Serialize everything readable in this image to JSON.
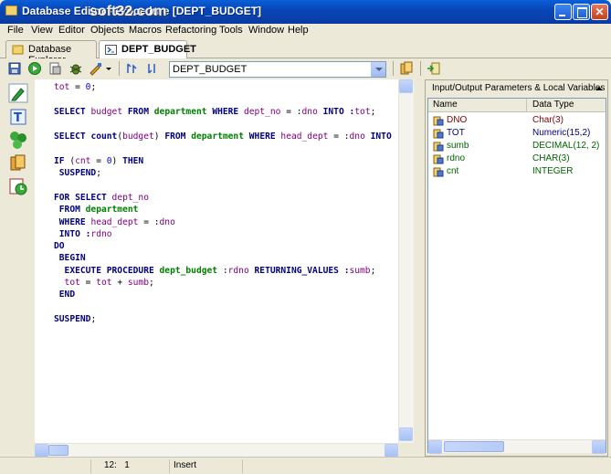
{
  "window": {
    "title": "Database Editor - Procedure [DEPT_BUDGET]",
    "watermark": "soft32.com"
  },
  "menu": [
    "File",
    "View",
    "Editor",
    "Objects",
    "Macros",
    "Refactoring",
    "Tools",
    "Window",
    "Help"
  ],
  "tabs": [
    {
      "label": "Database Explorer",
      "icon": "database-explorer-icon"
    },
    {
      "label": "DEPT_BUDGET",
      "icon": "procedure-icon"
    }
  ],
  "toolbar": {
    "procedure_select_value": "DEPT_BUDGET"
  },
  "colors": {
    "keyword": "#000080",
    "identifier": "#008000",
    "variable": "#800080",
    "number": "#0000ff"
  },
  "code_lines": [
    [
      {
        "t": "tot",
        "c": "var"
      },
      {
        "t": " = ",
        "c": "plain"
      },
      {
        "t": "0",
        "c": "num"
      },
      {
        "t": ";",
        "c": "plain"
      }
    ],
    [],
    [
      {
        "t": "SELECT ",
        "c": "kw"
      },
      {
        "t": "budget ",
        "c": "var"
      },
      {
        "t": "FROM ",
        "c": "kw"
      },
      {
        "t": "department ",
        "c": "id"
      },
      {
        "t": "WHERE ",
        "c": "kw"
      },
      {
        "t": "dept_no ",
        "c": "var"
      },
      {
        "t": "= :",
        "c": "plain"
      },
      {
        "t": "dno ",
        "c": "var"
      },
      {
        "t": "INTO :",
        "c": "kw"
      },
      {
        "t": "tot",
        "c": "var"
      },
      {
        "t": ";",
        "c": "plain"
      }
    ],
    [],
    [
      {
        "t": "SELECT ",
        "c": "kw"
      },
      {
        "t": "count",
        "c": "kw"
      },
      {
        "t": "(",
        "c": "plain"
      },
      {
        "t": "budget",
        "c": "var"
      },
      {
        "t": ") ",
        "c": "plain"
      },
      {
        "t": "FROM ",
        "c": "kw"
      },
      {
        "t": "department ",
        "c": "id"
      },
      {
        "t": "WHERE ",
        "c": "kw"
      },
      {
        "t": "head_dept ",
        "c": "var"
      },
      {
        "t": "= :",
        "c": "plain"
      },
      {
        "t": "dno ",
        "c": "var"
      },
      {
        "t": "INTO",
        "c": "kw"
      }
    ],
    [],
    [
      {
        "t": "IF ",
        "c": "kw"
      },
      {
        "t": "(",
        "c": "plain"
      },
      {
        "t": "cnt",
        "c": "var"
      },
      {
        "t": " = ",
        "c": "plain"
      },
      {
        "t": "0",
        "c": "num"
      },
      {
        "t": ") ",
        "c": "plain"
      },
      {
        "t": "THEN",
        "c": "kw"
      }
    ],
    [
      {
        "t": " SUSPEND",
        "c": "kw"
      },
      {
        "t": ";",
        "c": "plain"
      }
    ],
    [],
    [
      {
        "t": "FOR SELECT ",
        "c": "kw"
      },
      {
        "t": "dept_no",
        "c": "var"
      }
    ],
    [
      {
        "t": " FROM ",
        "c": "kw"
      },
      {
        "t": "department",
        "c": "id"
      }
    ],
    [
      {
        "t": " WHERE ",
        "c": "kw"
      },
      {
        "t": "head_dept ",
        "c": "var"
      },
      {
        "t": "= :",
        "c": "plain"
      },
      {
        "t": "dno",
        "c": "var"
      }
    ],
    [
      {
        "t": " INTO :",
        "c": "kw"
      },
      {
        "t": "rdno",
        "c": "var"
      }
    ],
    [
      {
        "t": "DO",
        "c": "kw"
      }
    ],
    [
      {
        "t": " BEGIN",
        "c": "kw"
      }
    ],
    [
      {
        "t": "  EXECUTE PROCEDURE ",
        "c": "kw"
      },
      {
        "t": "dept_budget ",
        "c": "id"
      },
      {
        "t": ":",
        "c": "plain"
      },
      {
        "t": "rdno ",
        "c": "var"
      },
      {
        "t": "RETURNING_VALUES :",
        "c": "kw"
      },
      {
        "t": "sumb",
        "c": "var"
      },
      {
        "t": ";",
        "c": "plain"
      }
    ],
    [
      {
        "t": "  tot",
        "c": "var"
      },
      {
        "t": " = ",
        "c": "plain"
      },
      {
        "t": "tot",
        "c": "var"
      },
      {
        "t": " + ",
        "c": "plain"
      },
      {
        "t": "sumb",
        "c": "var"
      },
      {
        "t": ";",
        "c": "plain"
      }
    ],
    [
      {
        "t": " END",
        "c": "kw"
      }
    ],
    [],
    [
      {
        "t": "SUSPEND",
        "c": "kw"
      },
      {
        "t": ";",
        "c": "plain"
      }
    ]
  ],
  "params_panel": {
    "title": "Input/Output Parameters & Local Variables",
    "col_name": "Name",
    "col_type": "Data Type",
    "rows": [
      {
        "name": "DNO",
        "type": "Char(3)",
        "color": "#800000"
      },
      {
        "name": "TOT",
        "type": "Numeric(15,2)",
        "color": "#000080"
      },
      {
        "name": "sumb",
        "type": "DECIMAL(12, 2)",
        "color": "#006400"
      },
      {
        "name": "rdno",
        "type": "CHAR(3)",
        "color": "#006400"
      },
      {
        "name": "cnt",
        "type": "INTEGER",
        "color": "#006400"
      }
    ]
  },
  "status": {
    "cursor_line": "12",
    "cursor_col": "1",
    "mode": "Insert"
  }
}
